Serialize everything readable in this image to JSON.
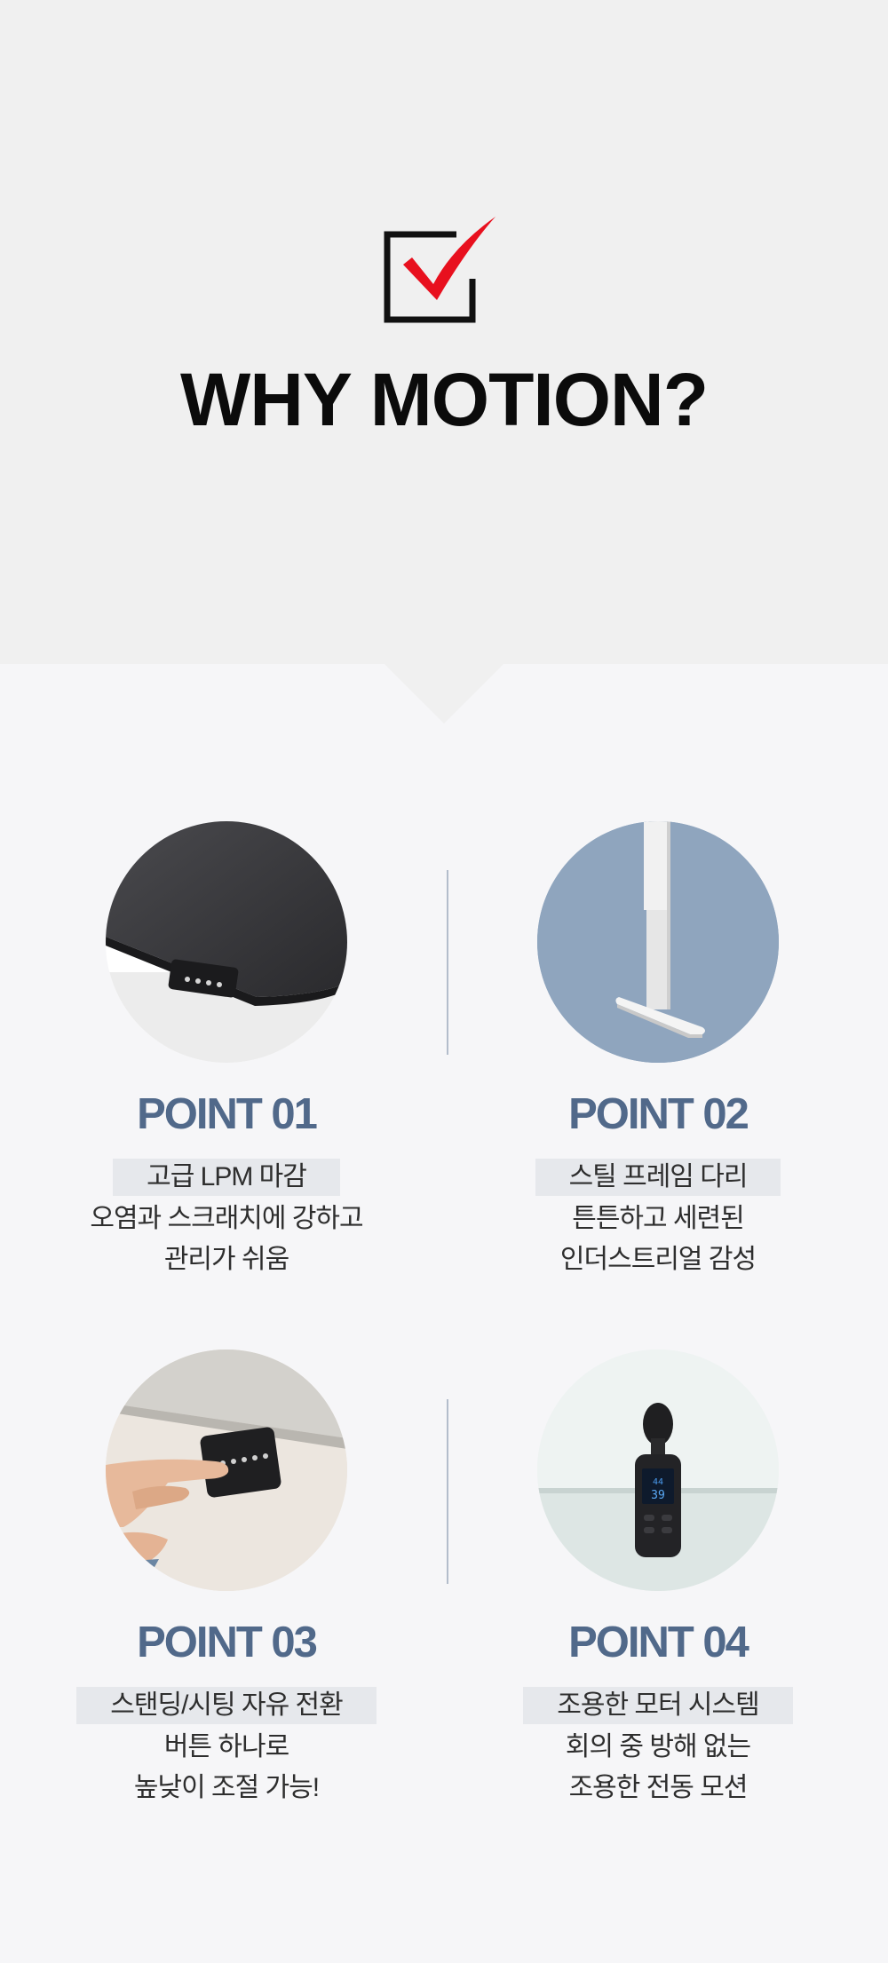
{
  "hero": {
    "title": "WHY MOTION?",
    "icon": "checkbox-check-icon",
    "background": "#f0f0f0",
    "accent": "#e8101e"
  },
  "points": [
    {
      "title": "POINT 01",
      "highlight": "고급 LPM 마감",
      "line1": "오염과 스크래치에 강하고",
      "line2": "관리가 쉬움",
      "image": "black-desktop-with-controller"
    },
    {
      "title": "POINT 02",
      "highlight": "스틸 프레임 다리",
      "line1": "튼튼하고 세련된",
      "line2": "인더스트리얼 감성",
      "image": "white-steel-frame-leg"
    },
    {
      "title": "POINT 03",
      "highlight": "스탠딩/시팅 자유 전환",
      "line1": "버튼 하나로",
      "line2": "높낮이 조절 가능!",
      "image": "finger-pressing-height-controller"
    },
    {
      "title": "POINT 04",
      "highlight": "조용한 모터 시스템",
      "line1": "회의 중 방해 없는",
      "line2": "조용한 전동 모션",
      "image": "sound-level-meter"
    }
  ],
  "colors": {
    "point_title": "#51698a",
    "page_bg": "#f6f6f8",
    "highlight_bg": "#e6e8ec",
    "divider": "#b3bdcb"
  }
}
